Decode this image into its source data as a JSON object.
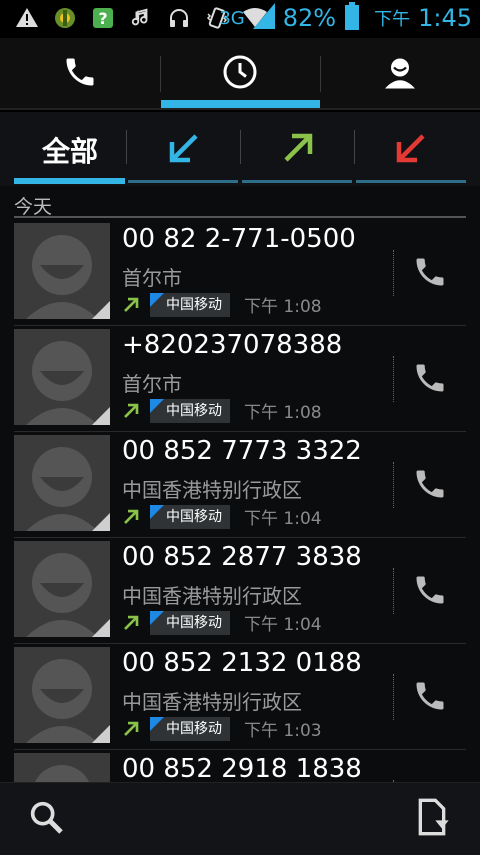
{
  "status_bar": {
    "network": "3G",
    "battery": "82%",
    "ampm": "下午",
    "time": "1:45",
    "icons": [
      "warning-icon",
      "app-icon",
      "help-icon",
      "music-icon",
      "headset-icon",
      "vibrate-icon",
      "wifi-icon",
      "signal-icon",
      "battery-icon"
    ]
  },
  "tabs": [
    {
      "name": "dialer",
      "icon": "phone-icon",
      "active": false
    },
    {
      "name": "call-log",
      "icon": "clock-icon",
      "active": true
    },
    {
      "name": "contacts",
      "icon": "person-icon",
      "active": false
    }
  ],
  "filters": {
    "all_label": "全部",
    "items": [
      {
        "name": "all",
        "active": true
      },
      {
        "name": "incoming",
        "icon": "incoming-arrow-icon",
        "color": "#33b5e5"
      },
      {
        "name": "outgoing",
        "icon": "outgoing-arrow-icon",
        "color": "#8bc34a"
      },
      {
        "name": "missed",
        "icon": "missed-arrow-icon",
        "color": "#e53935"
      }
    ]
  },
  "section": {
    "label": "今天"
  },
  "calls": [
    {
      "number": "00 82 2-771-0500",
      "location": "首尔市",
      "carrier": "中国移动",
      "time": "下午 1:08"
    },
    {
      "number": "+820237078388",
      "location": "首尔市",
      "carrier": "中国移动",
      "time": "下午 1:08"
    },
    {
      "number": "00 852 7773 3322",
      "location": "中国香港特别行政区",
      "carrier": "中国移动",
      "time": "下午 1:04"
    },
    {
      "number": "00 852 2877 3838",
      "location": "中国香港特别行政区",
      "carrier": "中国移动",
      "time": "下午 1:04"
    },
    {
      "number": "00 852 2132 0188",
      "location": "中国香港特别行政区",
      "carrier": "中国移动",
      "time": "下午 1:03"
    },
    {
      "number": "00 852 2918 1838",
      "location": "",
      "carrier": "",
      "time": ""
    }
  ],
  "bottom_bar": {
    "icons": [
      "search-icon",
      "export-icon"
    ]
  },
  "colors": {
    "accent": "#33b5e5",
    "outgoing": "#8bc34a",
    "missed": "#e53935"
  }
}
